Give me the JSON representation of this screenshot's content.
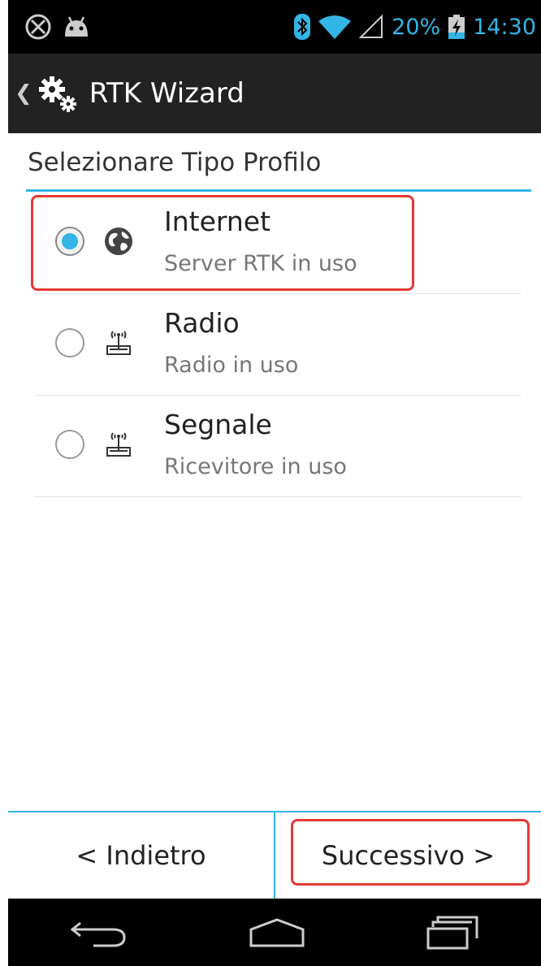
{
  "status_bar": {
    "battery_percent": "20%",
    "time": "14:30",
    "icons": [
      "gps-off-icon",
      "android-icon",
      "bluetooth-icon",
      "wifi-icon",
      "signal-icon",
      "battery-charging-icon"
    ]
  },
  "action_bar": {
    "title": "RTK Wizard",
    "icon": "settings-gears-icon"
  },
  "header": {
    "title": "Selezionare Tipo Profilo"
  },
  "options": [
    {
      "title": "Internet",
      "subtitle": "Server RTK in uso",
      "icon": "globe-icon",
      "selected": true
    },
    {
      "title": "Radio",
      "subtitle": "Radio in uso",
      "icon": "antenna-icon",
      "selected": false
    },
    {
      "title": "Segnale",
      "subtitle": "Ricevitore in uso",
      "icon": "antenna-icon",
      "selected": false
    }
  ],
  "buttons": {
    "back_label": "< Indietro",
    "next_label": "Successivo >"
  },
  "colors": {
    "accent": "#33b5e5",
    "highlight": "#e53935",
    "status_bar": "#000000",
    "action_bar": "#222222"
  }
}
